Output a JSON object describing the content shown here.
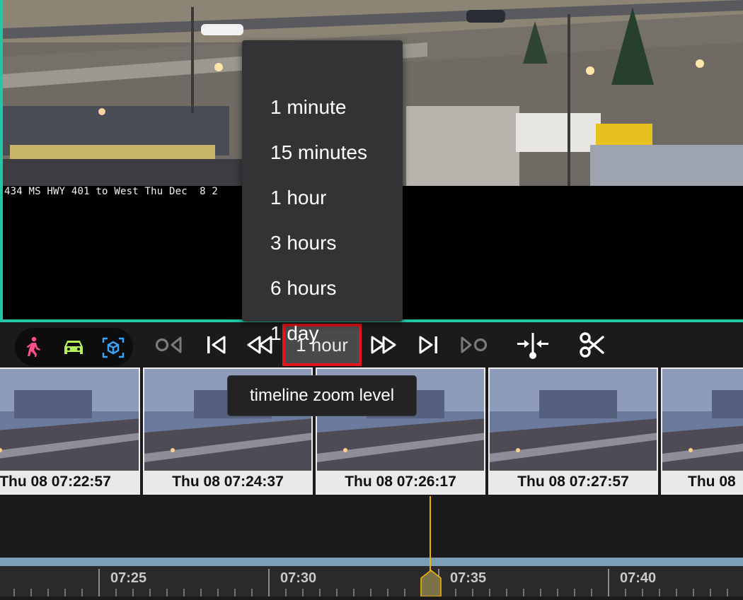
{
  "camera_overlay": "434 MS HWY 401 to West Thu Dec  8 2",
  "zoom_menu": {
    "options": [
      "1 minute",
      "15 minutes",
      "1 hour",
      "3 hours",
      "6 hours",
      "1 day"
    ]
  },
  "toolbar": {
    "detection_filters": [
      "person-icon",
      "car-icon",
      "object-cube-icon"
    ],
    "controls": [
      "prev-event-icon",
      "skip-to-start-icon",
      "rewind-icon",
      "fast-forward-icon",
      "skip-to-end-icon",
      "next-event-icon",
      "center-timeline-icon",
      "clip-scissors-icon"
    ],
    "zoom_label": "1 hour"
  },
  "tooltip": {
    "text": "timeline zoom level"
  },
  "thumbnails": [
    {
      "label": "Thu 08 07:22:57"
    },
    {
      "label": "Thu 08 07:24:37"
    },
    {
      "label": "Thu 08 07:26:17"
    },
    {
      "label": "Thu 08 07:27:57"
    },
    {
      "label": "Thu 08"
    }
  ],
  "timeline": {
    "ticks": [
      "07:25",
      "07:30",
      "07:35",
      "07:40"
    ]
  },
  "colors": {
    "accent": "#1fc7a7",
    "highlight": "#e3151b",
    "person": "#ff4f8a",
    "car": "#b6ee5c",
    "object": "#3aa7ff",
    "playhead": "#f0b400",
    "timeline_band": "#7b9fb6"
  }
}
